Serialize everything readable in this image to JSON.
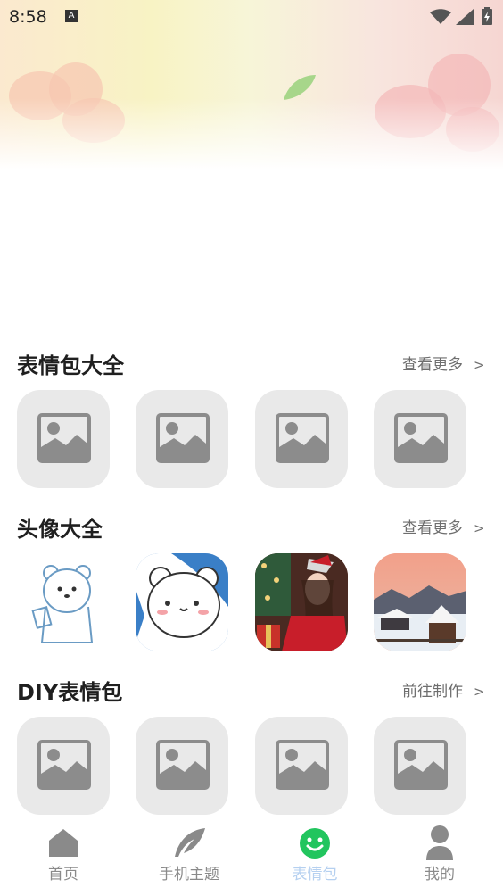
{
  "status_bar": {
    "time": "8:58",
    "notification_icon": "A"
  },
  "sections": [
    {
      "title": "表情包大全",
      "action": "查看更多",
      "chevron": ">"
    },
    {
      "title": "头像大全",
      "action": "查看更多",
      "chevron": ">"
    },
    {
      "title": "DIY表情包",
      "action": "前往制作",
      "chevron": ">"
    }
  ],
  "nav": [
    {
      "label": "首页",
      "icon": "home-icon"
    },
    {
      "label": "手机主题",
      "icon": "feather-icon"
    },
    {
      "label": "表情包",
      "icon": "smiley-icon",
      "active": true
    },
    {
      "label": "我的",
      "icon": "user-icon"
    }
  ],
  "colors": {
    "active_tab": "#b5d0f0",
    "smiley": "#22c55e",
    "placeholder_bg": "#e9e9e9"
  }
}
